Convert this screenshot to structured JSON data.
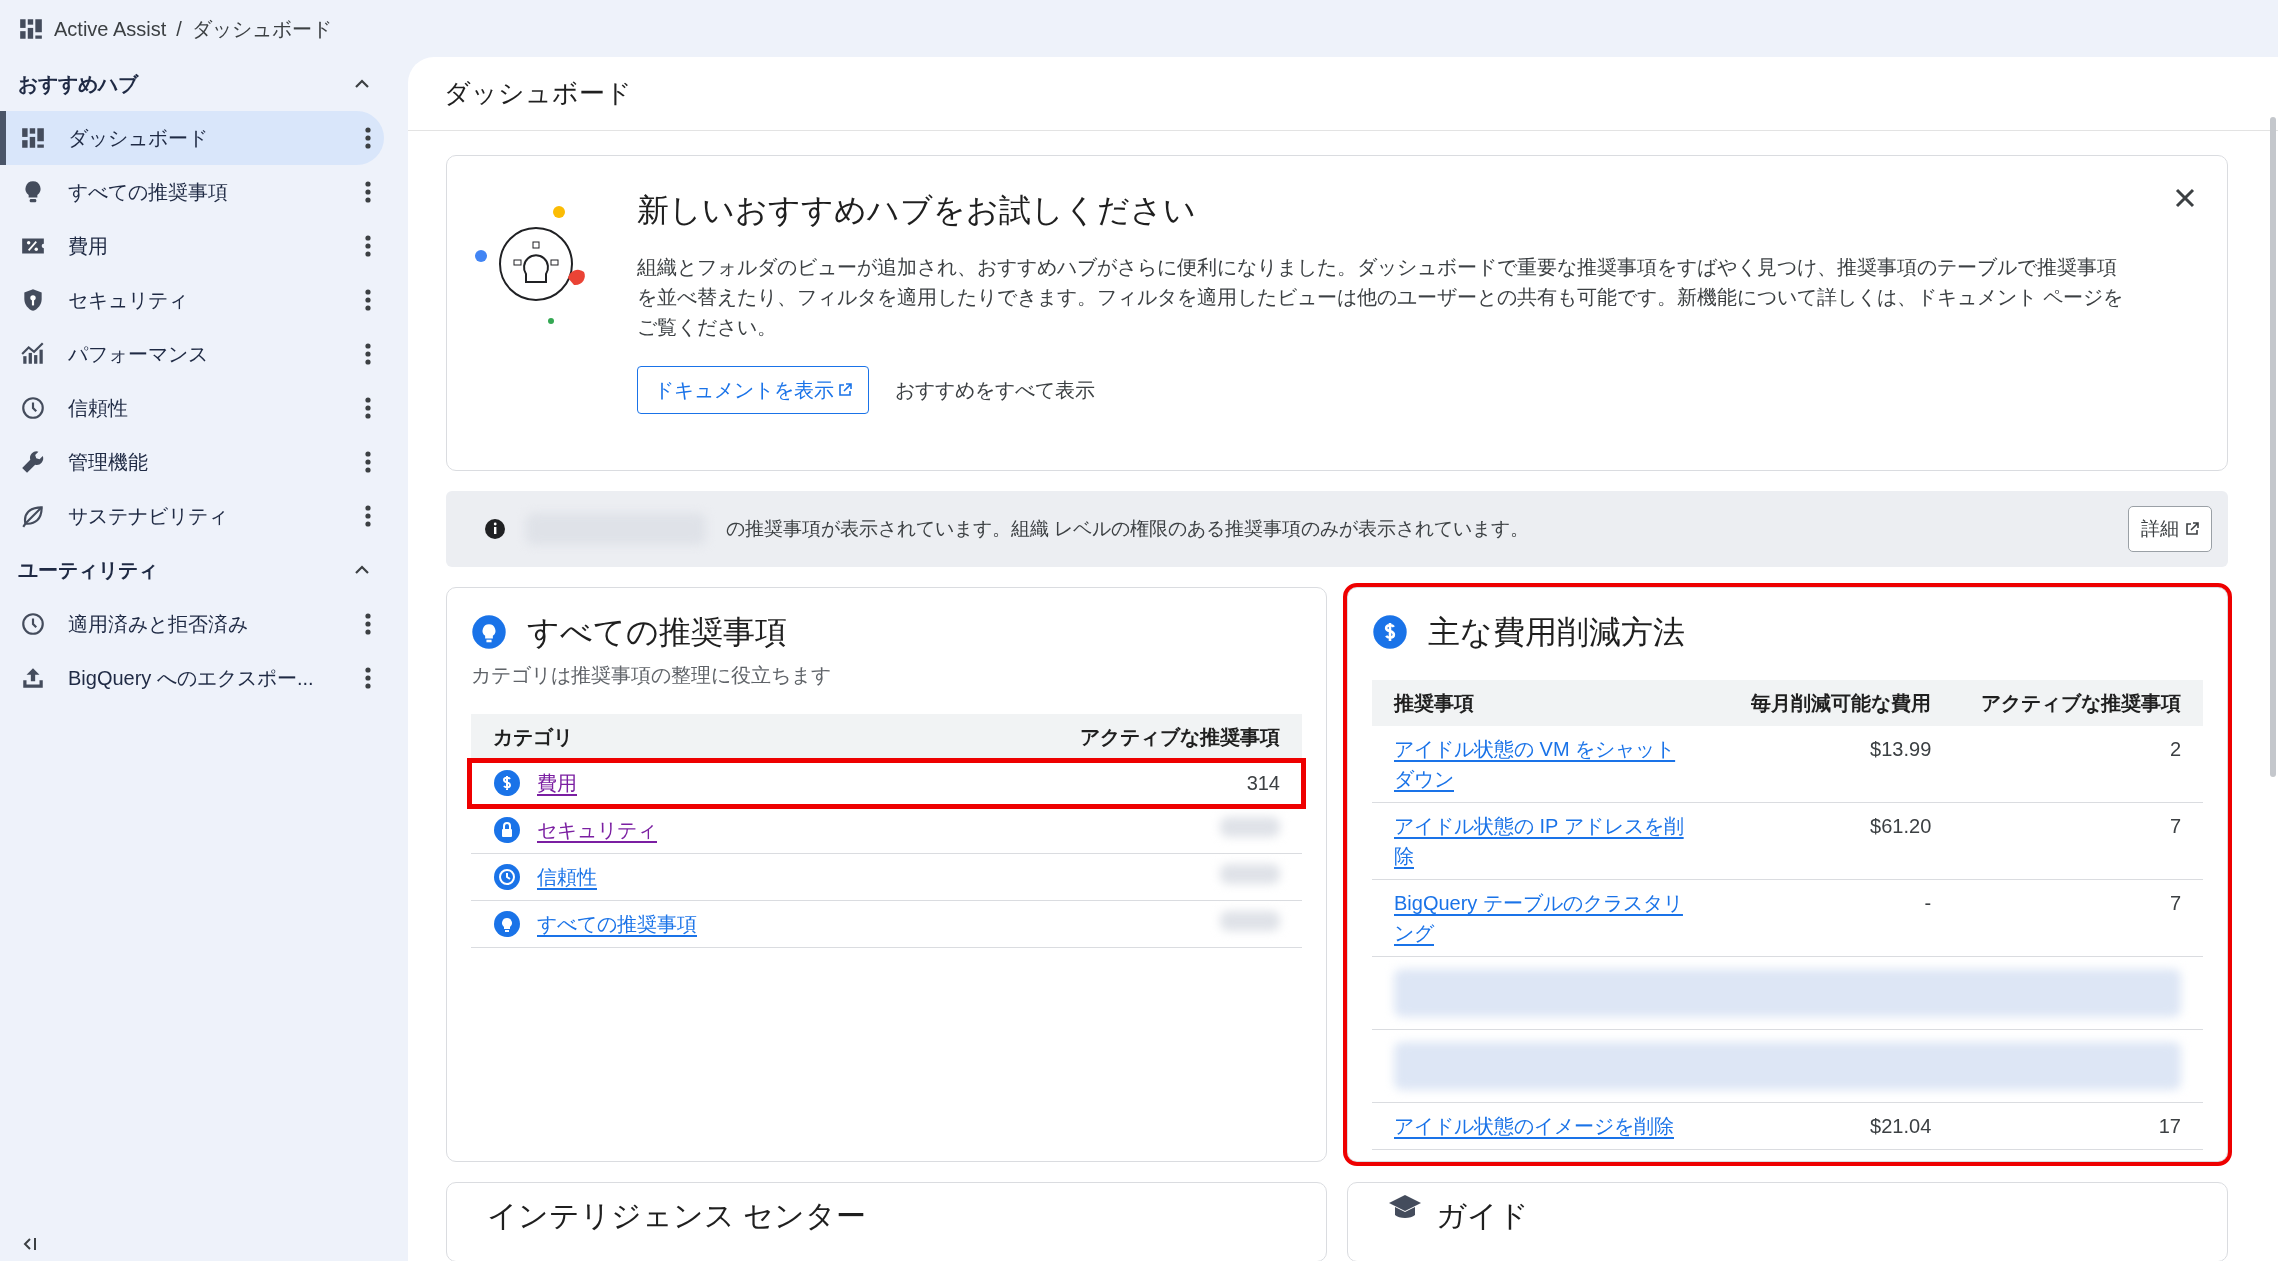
{
  "breadcrumb": {
    "app": "Active Assist",
    "separator": "/",
    "page": "ダッシュボード"
  },
  "sidebar": {
    "groups": [
      {
        "title": "おすすめハブ",
        "expanded": true,
        "items": [
          {
            "label": "ダッシュボード",
            "selected": true
          },
          {
            "label": "すべての推奨事項",
            "selected": false
          },
          {
            "label": "費用",
            "selected": false
          },
          {
            "label": "セキュリティ",
            "selected": false
          },
          {
            "label": "パフォーマンス",
            "selected": false
          },
          {
            "label": "信頼性",
            "selected": false
          },
          {
            "label": "管理機能",
            "selected": false
          },
          {
            "label": "サステナビリティ",
            "selected": false
          }
        ]
      },
      {
        "title": "ユーティリティ",
        "expanded": true,
        "items": [
          {
            "label": "適用済みと拒否済み",
            "selected": false
          },
          {
            "label": "BigQuery へのエクスポー...",
            "selected": false
          }
        ]
      }
    ]
  },
  "header": {
    "title": "ダッシュボード"
  },
  "promo": {
    "title": "新しいおすすめハブをお試しください",
    "body": "組織とフォルダのビューが追加され、おすすめハブがさらに便利になりました。ダッシュボードで重要な推奨事項をすばやく見つけ、推奨事項のテーブルで推奨事項を並べ替えたり、フィルタを適用したりできます。フィルタを適用したビューは他のユーザーとの共有も可能です。新機能について詳しくは、ドキュメント ページをご覧ください。",
    "primary_button": "ドキュメントを表示",
    "secondary_button": "おすすめをすべて表示"
  },
  "info_bar": {
    "text": "の推奨事項が表示されています。組織 レベルの権限のある推奨事項のみが表示されています。",
    "button": "詳細"
  },
  "categories_card": {
    "title": "すべての推奨事項",
    "subtitle": "カテゴリは推奨事項の整理に役立ちます",
    "columns": [
      "カテゴリ",
      "アクティブな推奨事項"
    ],
    "rows": [
      {
        "label": "費用",
        "count": "314",
        "visited": true,
        "highlight": true
      },
      {
        "label": "セキュリティ",
        "visited": true,
        "highlight": false
      },
      {
        "label": "信頼性",
        "visited": false,
        "highlight": false
      },
      {
        "label": "すべての推奨事項",
        "visited": false,
        "highlight": false
      }
    ]
  },
  "savings_card": {
    "title": "主な費用削減方法",
    "highlight": true,
    "columns": [
      "推奨事項",
      "毎月削減可能な費用",
      "アクティブな推奨事項"
    ],
    "rows": [
      {
        "kind": "link",
        "recommendation": "アイドル状態の VM をシャットダウン",
        "cost": "$13.99",
        "active": "2"
      },
      {
        "kind": "link",
        "recommendation": "アイドル状態の IP アドレスを削除",
        "cost": "$61.20",
        "active": "7"
      },
      {
        "kind": "link",
        "recommendation": "BigQuery テーブルのクラスタリング",
        "cost": "-",
        "active": "7"
      },
      {
        "kind": "blurred"
      },
      {
        "kind": "blurred"
      },
      {
        "kind": "link",
        "recommendation": "アイドル状態のイメージを削除",
        "cost": "$21.04",
        "active": "17"
      }
    ]
  },
  "bottom_cards": [
    {
      "title": "インテリジェンス センター"
    },
    {
      "title": "ガイド"
    }
  ]
}
